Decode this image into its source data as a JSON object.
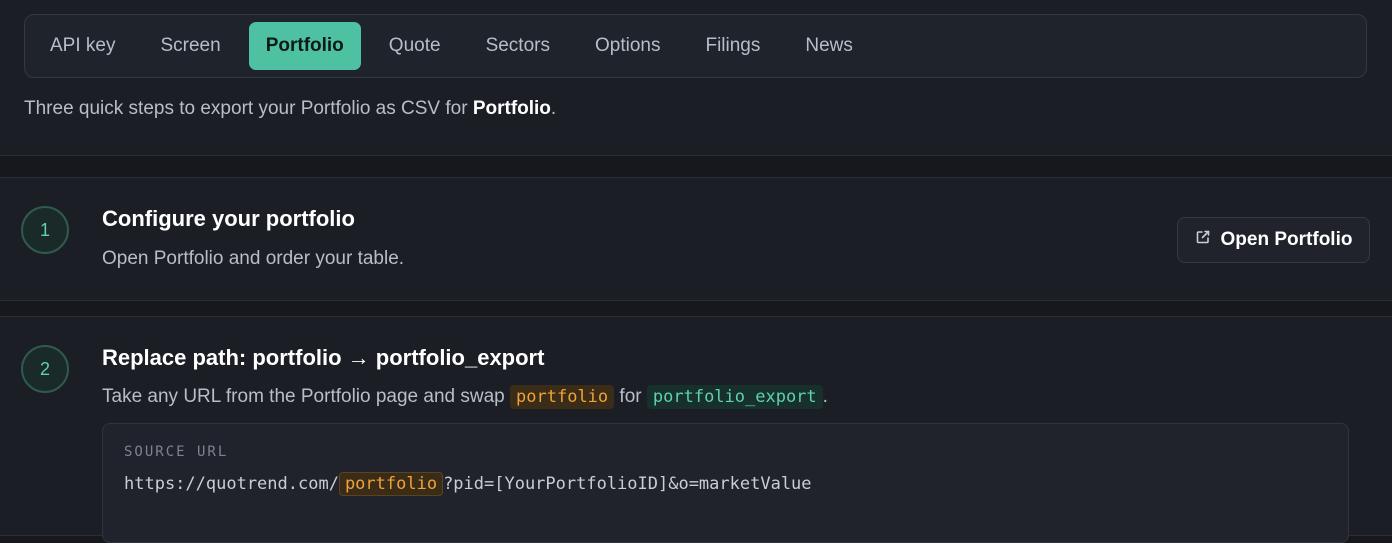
{
  "tabs": [
    {
      "label": "API key"
    },
    {
      "label": "Screen"
    },
    {
      "label": "Portfolio",
      "active": true
    },
    {
      "label": "Quote"
    },
    {
      "label": "Sectors"
    },
    {
      "label": "Options"
    },
    {
      "label": "Filings"
    },
    {
      "label": "News"
    }
  ],
  "intro": {
    "prefix": "Three quick steps to export your Portfolio as CSV for ",
    "bold": "Portfolio",
    "suffix": "."
  },
  "steps": [
    {
      "number": "1",
      "title": "Configure your portfolio",
      "description": "Open Portfolio and order your table.",
      "button_label": "Open Portfolio",
      "button_icon": "external-link-icon"
    },
    {
      "number": "2",
      "title": "Replace path: portfolio → portfolio_export",
      "desc_part1": "Take any URL from the Portfolio page and swap ",
      "code_from": "portfolio",
      "desc_part2": " for ",
      "code_to": "portfolio_export",
      "desc_part3": ".",
      "source_label": "SOURCE URL",
      "url_prefix": "https://quotrend.com/",
      "url_highlight": "portfolio",
      "url_suffix": "?pid=[YourPortfolioID]&o=marketValue"
    }
  ],
  "colors": {
    "accent": "#4fc1a3",
    "highlight_orange": "#f0a23a",
    "highlight_green": "#5ed1b1",
    "background": "#16181d"
  }
}
